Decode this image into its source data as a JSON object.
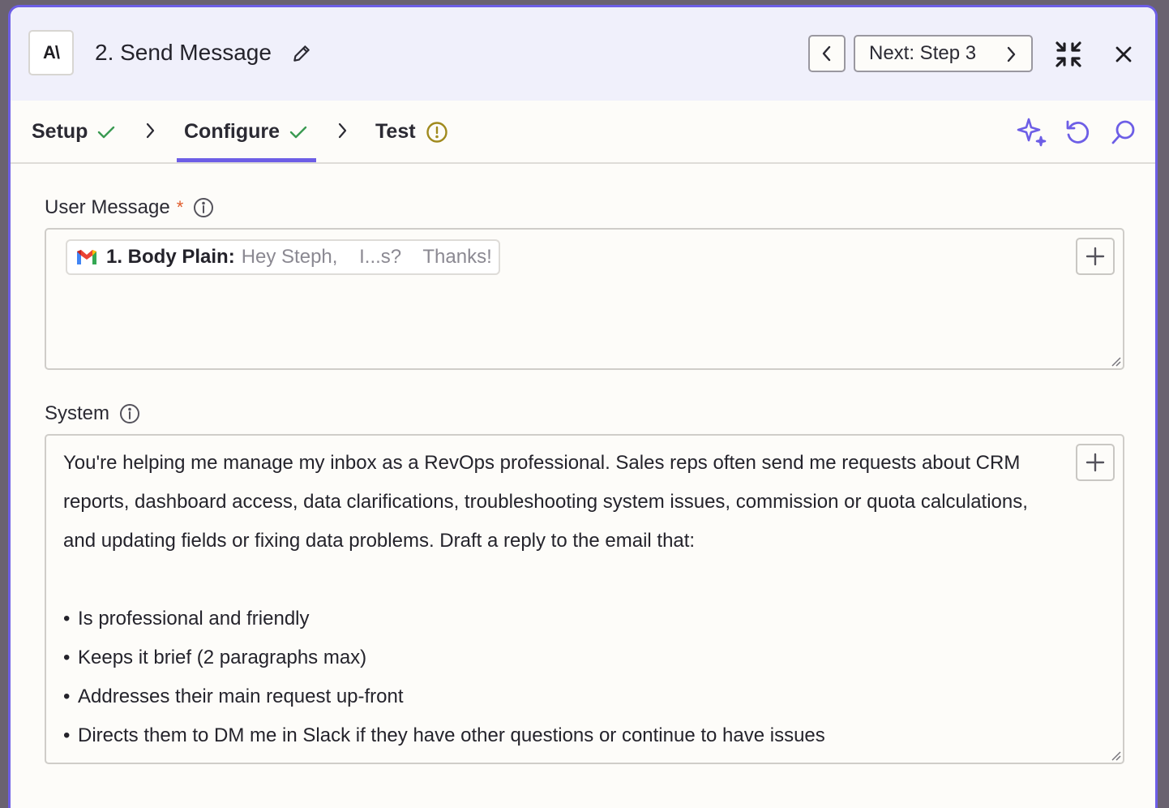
{
  "header": {
    "logo_text": "A\\",
    "title": "2. Send Message",
    "next_label": "Next: Step 3"
  },
  "tabs": [
    {
      "label": "Setup",
      "status": "complete"
    },
    {
      "label": "Configure",
      "status": "complete",
      "active": true
    },
    {
      "label": "Test",
      "status": "warning"
    }
  ],
  "user_message": {
    "label": "User Message",
    "required_mark": "*",
    "pill_label": "1. Body Plain:",
    "pill_value": "Hey Steph,    I...s?    Thanks!"
  },
  "system": {
    "label": "System",
    "paragraph": "You're helping me manage my inbox as a RevOps professional. Sales reps often send me requests about CRM reports, dashboard access, data clarifications, troubleshooting system issues, commission or quota calculations, and updating fields or fixing data problems. Draft a reply to the email that:",
    "bullets": [
      "Is professional and friendly",
      "Keeps it brief (2 paragraphs max)",
      "Addresses their main request up-front",
      "Directs them to DM me in Slack if they have other questions or continue to have issues"
    ]
  },
  "colors": {
    "accent": "#6d5ee6",
    "check": "#3a9a52",
    "warning": "#a08a1e",
    "required": "#e05b2a",
    "header_bg": "#f0f0fb"
  },
  "icons": {
    "edit": "pencil-icon",
    "prev": "chevron-left-icon",
    "next": "chevron-right-icon",
    "collapse": "collapse-icon",
    "close": "close-icon",
    "ai": "sparkle-icon",
    "undo": "undo-icon",
    "search": "search-icon",
    "info": "info-icon",
    "add": "plus-icon",
    "gmail": "gmail-icon"
  }
}
